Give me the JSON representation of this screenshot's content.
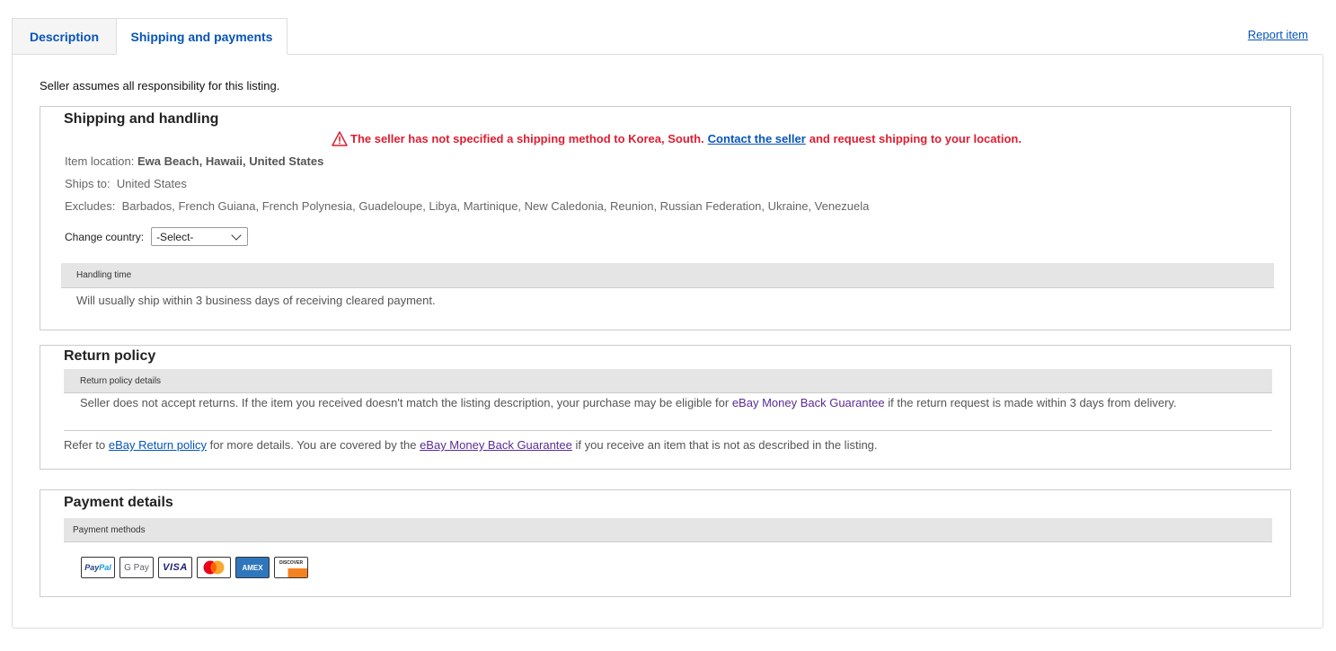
{
  "tabs": [
    {
      "label": "Description",
      "active": false
    },
    {
      "label": "Shipping and payments",
      "active": true
    }
  ],
  "report_link": "Report item",
  "seller_note": "Seller assumes all responsibility for this listing.",
  "shipping": {
    "title": "Shipping and handling",
    "warning_prefix": "The seller has not specified a shipping method to Korea, South.",
    "warning_link": "Contact the seller",
    "warning_suffix": "and request shipping to your location.",
    "item_location_label": "Item location:",
    "item_location_value": "Ewa Beach, Hawaii, United States",
    "ships_to_label": "Ships to:",
    "ships_to_value": "United States",
    "excludes_label": "Excludes:",
    "excludes_value": "Barbados, French Guiana, French Polynesia, Guadeloupe, Libya, Martinique, New Caledonia, Reunion, Russian Federation, Ukraine, Venezuela",
    "change_country_label": "Change country:",
    "country_select_value": "-Select-",
    "handling_header": "Handling time",
    "handling_text": "Will usually ship within 3 business days of receiving cleared payment."
  },
  "returns": {
    "title": "Return policy",
    "details_header": "Return policy details",
    "details_text_1": "Seller does not accept returns. If the item you received doesn't match the listing description, your purchase may be eligible for",
    "details_link": "eBay Money Back Guarantee",
    "details_text_2": "if the return request is made within 3 days from",
    "details_text_3": "delivery.",
    "refer_prefix": "Refer to",
    "refer_link": "eBay Return policy",
    "refer_middle": "for more details. You are covered by the",
    "refer_link_2": "eBay Money Back Guarantee",
    "refer_suffix": "if you receive an item that is not as described in the listing."
  },
  "payment": {
    "title": "Payment details",
    "methods_header": "Payment methods",
    "cards": {
      "paypal_a": "Pay",
      "paypal_b": "Pal",
      "gpay": "G Pay",
      "visa": "VISA",
      "amex": "AMEX",
      "discover": "DISCOVER"
    }
  },
  "colors": {
    "link": "#0654ba",
    "warning": "#dd1e31",
    "visited_link": "#5a2c95",
    "bar": "#e5e5e5"
  }
}
